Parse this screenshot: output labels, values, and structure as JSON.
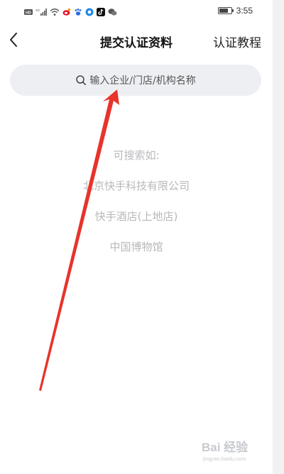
{
  "status_bar": {
    "time": "3:55",
    "battery_level": 0.8
  },
  "nav": {
    "back_icon": "chevron-left-icon",
    "title": "提交认证资料",
    "right_link": "认证教程"
  },
  "search": {
    "icon": "search-icon",
    "placeholder": "输入企业/门店/机构名称"
  },
  "hints": {
    "heading": "可搜索如:",
    "examples": [
      "北京快手科技有限公司",
      "快手酒店(上地店)",
      "中国博物馆"
    ]
  },
  "colors": {
    "arrow": "#e8332b",
    "search_bg": "#eeeff3",
    "hint_text": "#b8b8bc"
  },
  "watermark": {
    "text": "Bai 经验",
    "subtext": "jingyan.baidu.com"
  }
}
